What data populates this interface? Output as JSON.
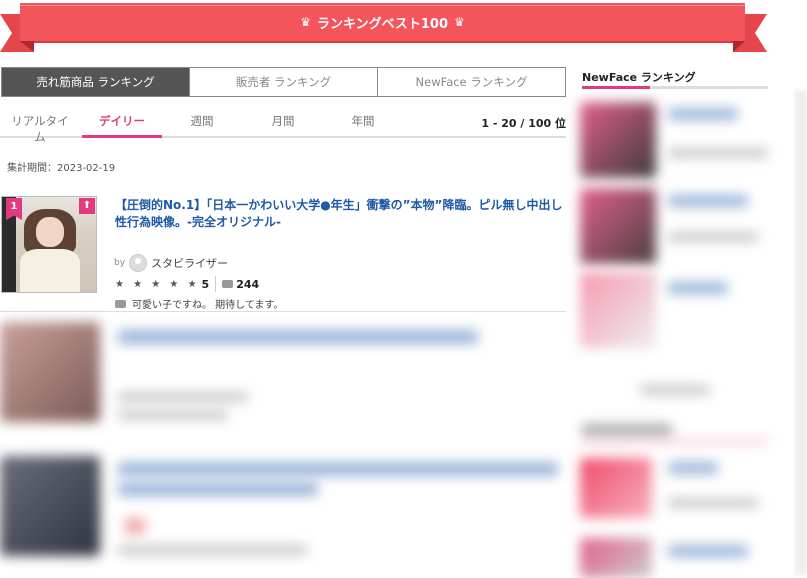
{
  "banner": {
    "title": "ランキングベスト100"
  },
  "top_tabs": [
    {
      "label": "売れ筋商品 ランキング",
      "active": true
    },
    {
      "label": "販売者 ランキング",
      "active": false
    },
    {
      "label": "NewFace ランキング",
      "active": false
    }
  ],
  "sub_tabs": [
    {
      "label": "リアルタイム",
      "active": false
    },
    {
      "label": "デイリー",
      "active": true
    },
    {
      "label": "週間",
      "active": false
    },
    {
      "label": "月間",
      "active": false
    },
    {
      "label": "年間",
      "active": false
    }
  ],
  "page_count": "1 - 20 / 100 位",
  "period": "集計期間：2023-02-19",
  "items": [
    {
      "rank": "1",
      "rank_change": "up",
      "title": "【圧倒的No.1】「日本一かわいい大学●年生」衝撃の”本物”降臨。ピル無し中出し性行為映像。-完全オリジナル-",
      "by_label": "by",
      "seller": "スタビライザー",
      "stars": "★ ★ ★ ★ ★",
      "rating": "5",
      "comment_count": "244",
      "comment": "可愛い子ですね。 期待してます。"
    }
  ],
  "sidebar": {
    "title": "NewFace ランキング"
  },
  "colors": {
    "accent": "#e23a7e",
    "ribbon": "#f3555a",
    "link": "#1f5aa6"
  }
}
